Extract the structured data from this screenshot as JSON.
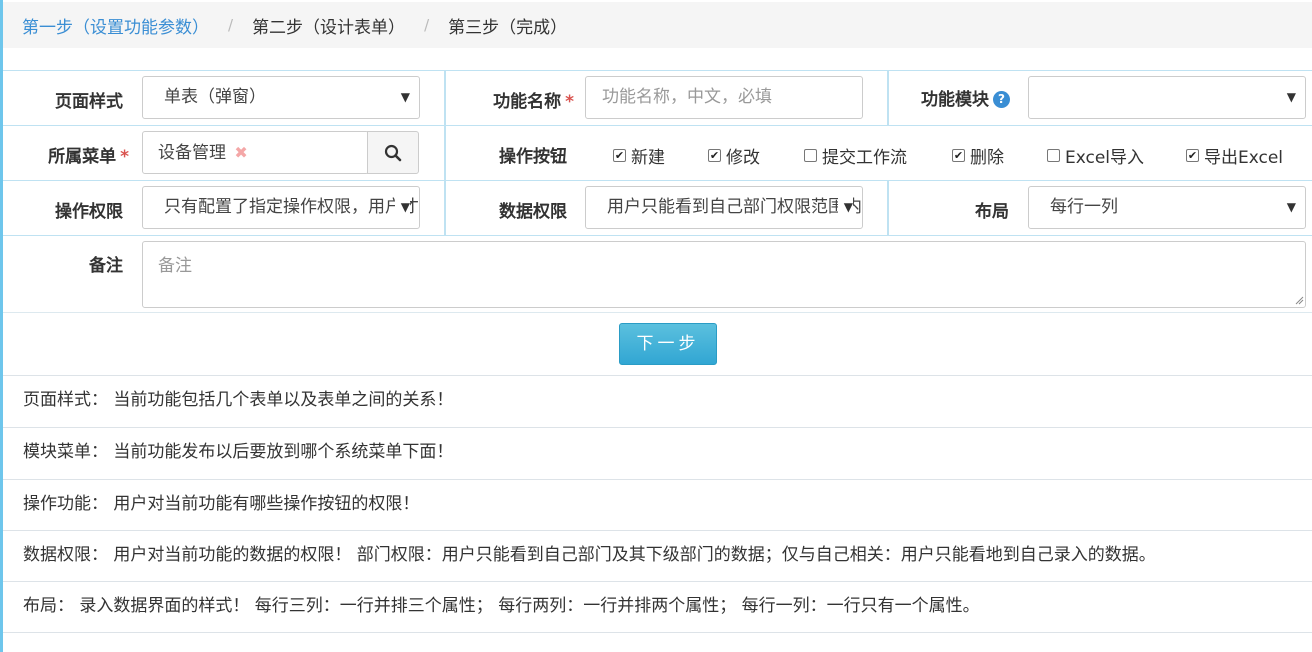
{
  "breadcrumb": {
    "step1": "第一步（设置功能参数）",
    "step2": "第二步（设计表单）",
    "step3": "第三步（完成）",
    "separator": "/"
  },
  "form": {
    "page_style": {
      "label": "页面样式",
      "value": "单表（弹窗）"
    },
    "func_name": {
      "label": "功能名称",
      "required": "*",
      "placeholder": "功能名称，中文，必填"
    },
    "func_module": {
      "label": "功能模块",
      "help_icon": "question-circle-icon",
      "value": ""
    },
    "menu": {
      "label": "所属菜单",
      "required": "*",
      "tag": "设备管理",
      "clear": "✖",
      "search_icon": "search-icon"
    },
    "op_buttons": {
      "label": "操作按钮",
      "options": [
        {
          "text": "新建",
          "checked": true,
          "mark": "✔"
        },
        {
          "text": "修改",
          "checked": true,
          "mark": "✔"
        },
        {
          "text": "提交工作流",
          "checked": false,
          "mark": ""
        },
        {
          "text": "删除",
          "checked": true,
          "mark": "✔"
        },
        {
          "text": "Excel导入",
          "checked": false,
          "mark": ""
        },
        {
          "text": "导出Excel",
          "checked": true,
          "mark": "✔"
        }
      ]
    },
    "op_permission": {
      "label": "操作权限",
      "value": "只有配置了指定操作权限，用户才能操作"
    },
    "data_permission": {
      "label": "数据权限",
      "value": "用户只能看到自己部门权限范围内的数据"
    },
    "layout": {
      "label": "布局",
      "value": "每行一列"
    },
    "remark": {
      "label": "备注",
      "placeholder": "备注"
    }
  },
  "next_button": "下一步",
  "notes": [
    "页面样式： 当前功能包括几个表单以及表单之间的关系！",
    "模块菜单： 当前功能发布以后要放到哪个系统菜单下面！",
    "操作功能： 用户对当前功能有哪些操作按钮的权限！",
    "数据权限： 用户对当前功能的数据的权限！ 部门权限：用户只能看到自己部门及其下级部门的数据；仅与自己相关：用户只能看地到自己录入的数据。",
    "布局： 录入数据界面的样式！ 每行三列：一行并排三个属性； 每行两列：一行并排两个属性； 每行一列：一行只有一个属性。"
  ],
  "colors": {
    "accent": "#3a8ed4",
    "button": "#5bc0de",
    "required": "#d9534f",
    "border": "#bfe2f2"
  }
}
